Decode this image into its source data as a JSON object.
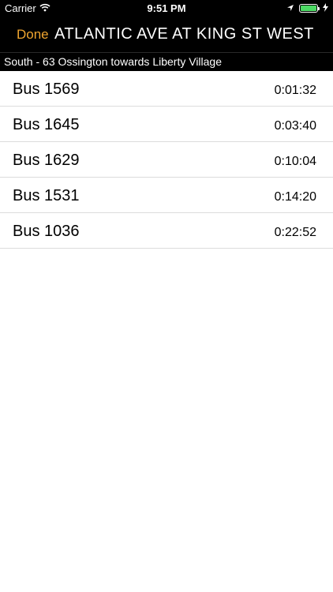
{
  "status_bar": {
    "carrier": "Carrier",
    "time": "9:51 PM"
  },
  "nav": {
    "done_label": "Done",
    "title": "ATLANTIC AVE AT KING ST WEST"
  },
  "route": {
    "direction": "South - 63 Ossington towards Liberty Village"
  },
  "arrivals": [
    {
      "bus": "Bus 1569",
      "eta": "0:01:32"
    },
    {
      "bus": "Bus 1645",
      "eta": "0:03:40"
    },
    {
      "bus": "Bus 1629",
      "eta": "0:10:04"
    },
    {
      "bus": "Bus 1531",
      "eta": "0:14:20"
    },
    {
      "bus": "Bus 1036",
      "eta": "0:22:52"
    }
  ],
  "colors": {
    "accent": "#f0a52f",
    "background": "#000000",
    "battery": "#4cd964"
  },
  "icons": [
    "wifi-icon",
    "location-arrow-icon",
    "battery-icon",
    "charging-bolt-icon"
  ]
}
